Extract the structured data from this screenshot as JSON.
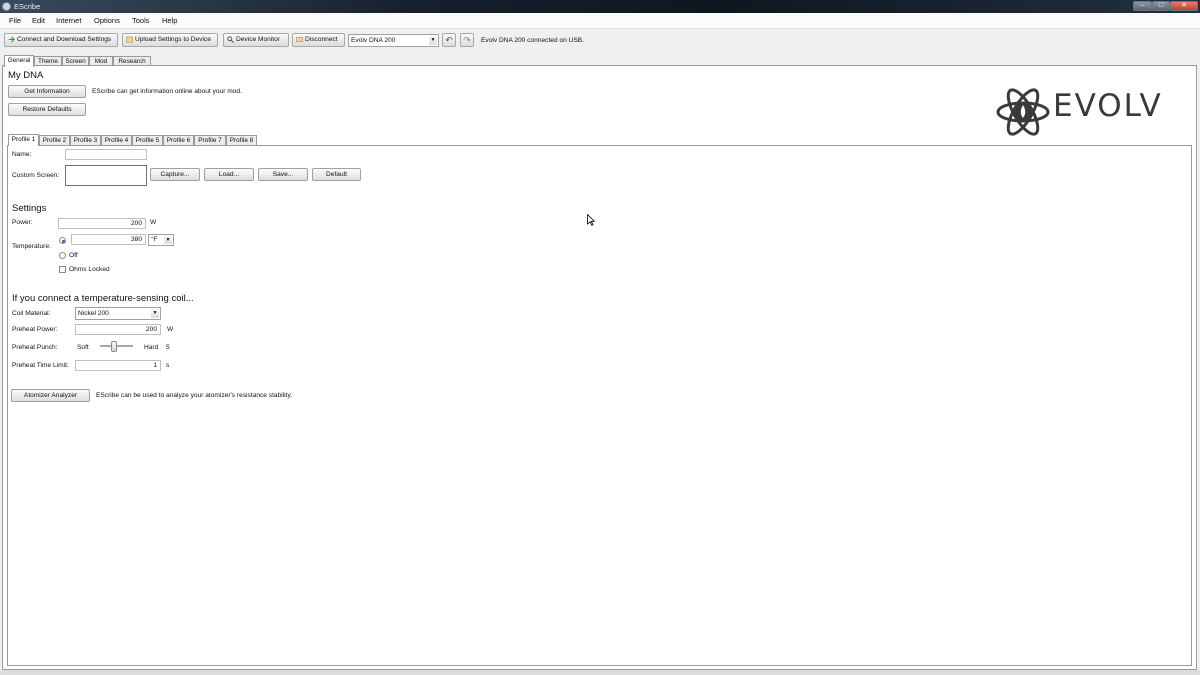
{
  "window": {
    "title": "EScribe"
  },
  "menu": [
    "File",
    "Edit",
    "Internet",
    "Options",
    "Tools",
    "Help"
  ],
  "toolbar": {
    "connect_label": "Connect and Download Settings",
    "upload_label": "Upload Settings to Device",
    "monitor_label": "Device Monitor",
    "disconnect_label": "Disconnect",
    "device_select": "Evolv DNA 200",
    "status": "Evolv DNA 200 connected on USB."
  },
  "main_tabs": [
    "General",
    "Theme",
    "Screen",
    "Mod",
    "Research"
  ],
  "my_dna": {
    "heading": "My DNA",
    "get_info_label": "Get Information",
    "get_info_desc": "EScribe can get information online about your mod.",
    "restore_label": "Restore Defaults"
  },
  "brand": {
    "logo_text": "EVOLV"
  },
  "profile_tabs": [
    "Profile 1",
    "Profile 2",
    "Profile 3",
    "Profile 4",
    "Profile 5",
    "Profile 6",
    "Profile 7",
    "Profile 8"
  ],
  "profile": {
    "name_label": "Name:",
    "name_value": "",
    "custom_screen_label": "Custom Screen:",
    "capture_label": "Capture...",
    "load_label": "Load...",
    "save_label": "Save...",
    "default_label": "Default"
  },
  "settings": {
    "heading": "Settings",
    "power_label": "Power:",
    "power_value": "200",
    "power_unit": "W",
    "temperature_label": "Temperature:",
    "temperature_value": "380",
    "temperature_unit": "°F",
    "off_label": "Off",
    "ohms_locked_label": "Ohms Locked"
  },
  "coil": {
    "heading": "If you connect a temperature-sensing coil...",
    "material_label": "Coil Material:",
    "material_value": "Nickel 200",
    "preheat_power_label": "Preheat Power:",
    "preheat_power_value": "200",
    "preheat_power_unit": "W",
    "preheat_punch_label": "Preheat Punch:",
    "soft_label": "Soft",
    "hard_label": "Hard",
    "punch_value": "5",
    "time_limit_label": "Preheat Time Limit:",
    "time_limit_value": "1",
    "time_unit": "s"
  },
  "atomizer": {
    "button_label": "Atomizer Analyzer",
    "desc": "EScribe can be used to analyze your atomizer's resistance stability."
  },
  "colors": {
    "accent": "#2a5fb0",
    "titlebar": "#16202c"
  }
}
